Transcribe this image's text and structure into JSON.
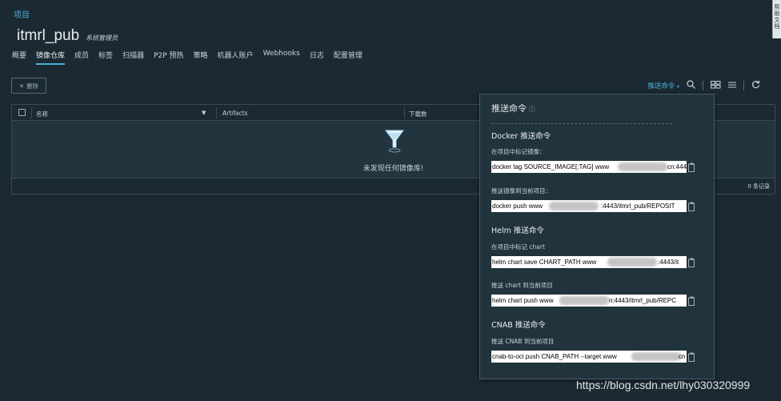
{
  "breadcrumb": "项目",
  "project": {
    "name": "itmrl_pub",
    "role": "系统管理员"
  },
  "tabs": [
    "概要",
    "镜像仓库",
    "成员",
    "标签",
    "扫描器",
    "P2P 预热",
    "策略",
    "机器人账户",
    "Webhooks",
    "日志",
    "配置管理"
  ],
  "active_tab": "镜像仓库",
  "toolbar": {
    "delete_label": "删除",
    "push_command_label": "推送命令"
  },
  "grid": {
    "columns": [
      "名称",
      "Artifacts",
      "下载数"
    ],
    "empty_text": "未发现任何镜像库!",
    "total": "0 条记录"
  },
  "popup": {
    "title": "推送命令",
    "sections": [
      {
        "title": "Docker 推送命令",
        "commands": [
          {
            "label": "在项目中标记镜像：",
            "pre": "docker tag SOURCE_IMAGE[:TAG] www",
            "post": "cn:444"
          },
          {
            "label": "推送镜像到当前项目：",
            "pre": "docker push www",
            "post": ":4443/itmrl_pub/REPOSIT"
          }
        ]
      },
      {
        "title": "Helm 推送命令",
        "commands": [
          {
            "label": "在项目中标记 chart",
            "pre": "helm chart save CHART_PATH www",
            "post": ":4443/it"
          },
          {
            "label": "推送 chart 到当前项目",
            "pre": "helm chart push www",
            "post": "n:4443/itmrl_pub/REPC"
          }
        ]
      },
      {
        "title": "CNAB 推送命令",
        "commands": [
          {
            "label": "推送 CNAB 到当前项目",
            "pre": "cnab-to-oci push CNAB_PATH --target www",
            "post": "cn"
          }
        ]
      }
    ]
  },
  "side_widget": "帮助文档",
  "watermark": "https://blog.csdn.net/lhy030320999",
  "colors": {
    "background": "#1b2a32",
    "accent": "#49afd9",
    "popup": "#21333c"
  }
}
